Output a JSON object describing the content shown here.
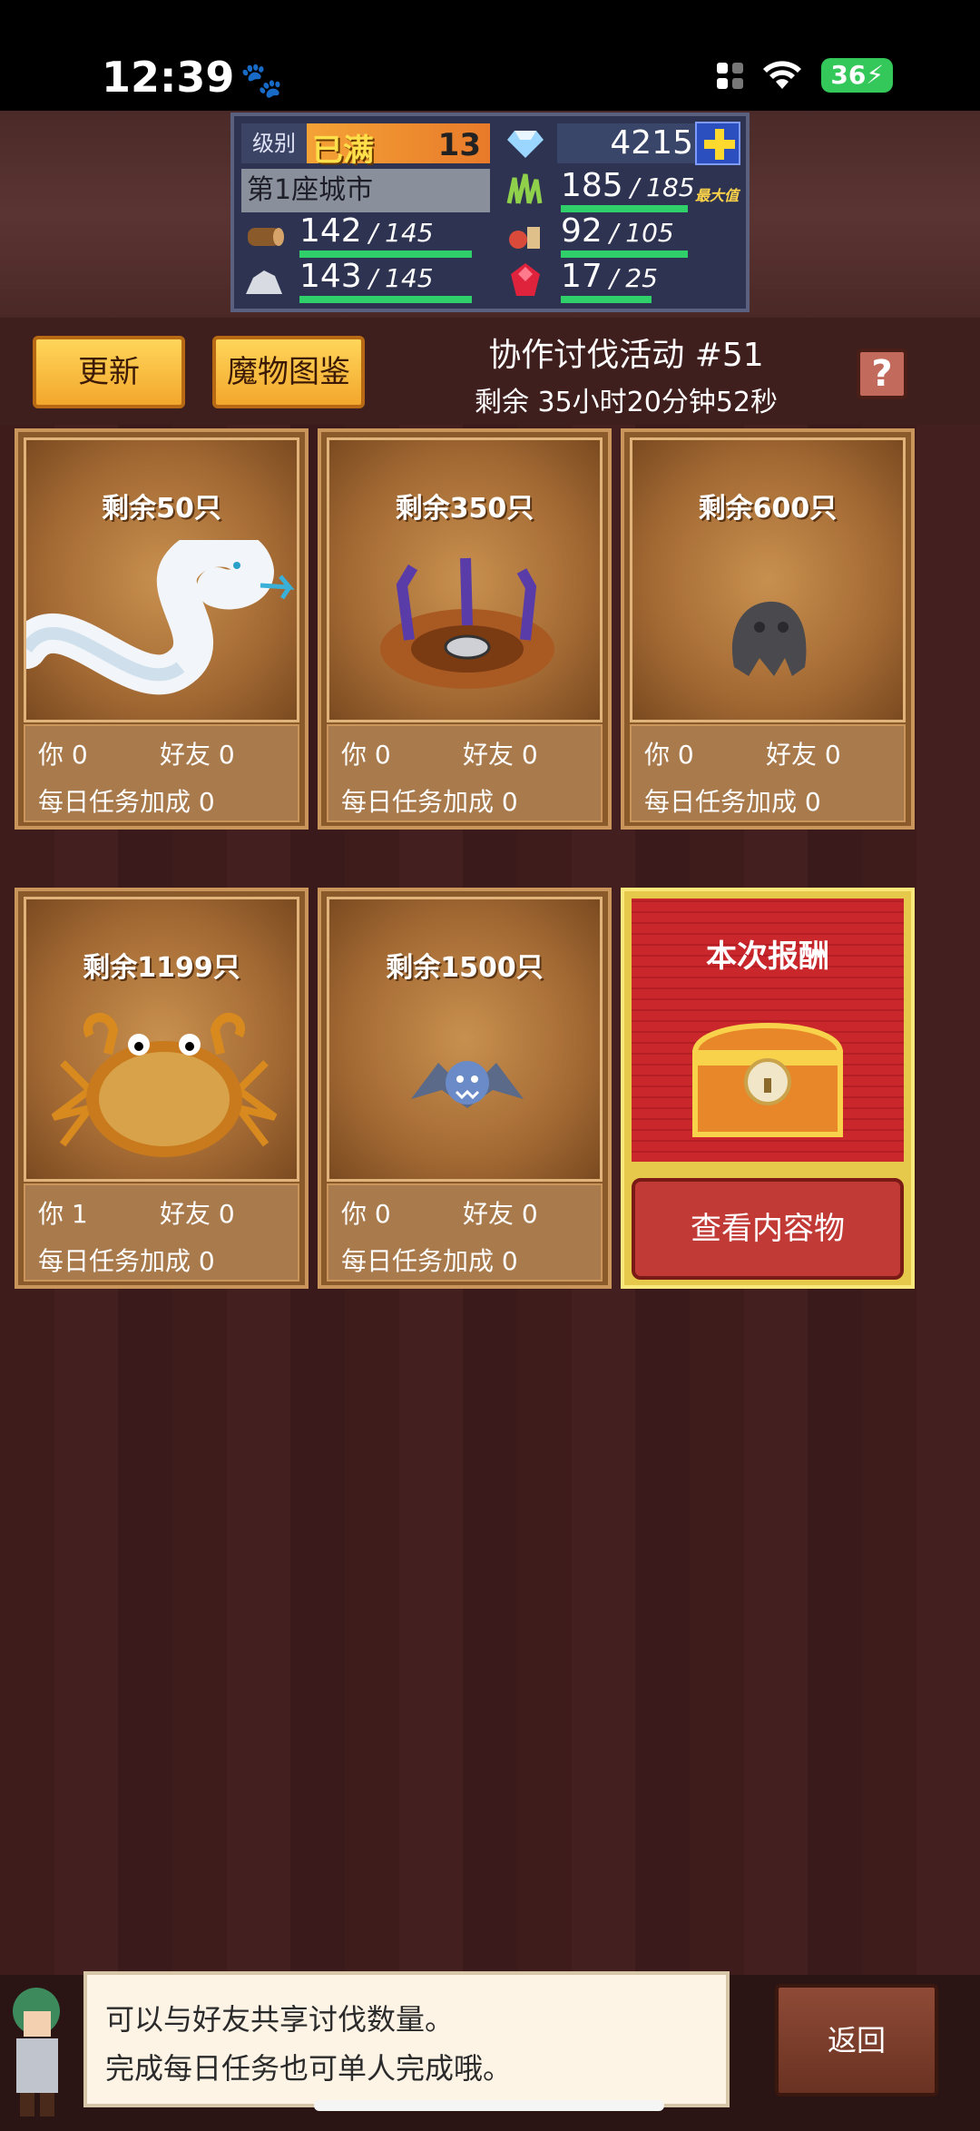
{
  "status": {
    "time": "12:39",
    "battery": "36"
  },
  "stats": {
    "level_label": "级别",
    "level_max": "已满",
    "level_num": "13",
    "gems": "4215",
    "city": "第1座城市",
    "grass": {
      "cur": "185",
      "max": "185",
      "tag": "最大值"
    },
    "wood": {
      "cur": "142",
      "max": "145"
    },
    "food": {
      "cur": "92",
      "max": "105"
    },
    "ore": {
      "cur": "143",
      "max": "145"
    },
    "ruby": {
      "cur": "17",
      "max": "25"
    },
    "sep": "/"
  },
  "header": {
    "refresh": "更新",
    "bestiary": "魔物图鉴",
    "title": "协作讨伐活动 #51",
    "timer": "剩余 35小时20分钟52秒",
    "help": "?"
  },
  "cards": [
    {
      "remaining": "剩余50只",
      "you": "你 0",
      "friend": "好友 0",
      "daily": "每日任务加成 0",
      "monster": "white-snake"
    },
    {
      "remaining": "剩余350只",
      "you": "你 0",
      "friend": "好友 0",
      "daily": "每日任务加成 0",
      "monster": "pit-trap"
    },
    {
      "remaining": "剩余600只",
      "you": "你 0",
      "friend": "好友 0",
      "daily": "每日任务加成 0",
      "monster": "rock-golem"
    },
    {
      "remaining": "剩余1199只",
      "you": "你 1",
      "friend": "好友 0",
      "daily": "每日任务加成 0",
      "monster": "crab"
    },
    {
      "remaining": "剩余1500只",
      "you": "你 0",
      "friend": "好友 0",
      "daily": "每日任务加成 0",
      "monster": "bat"
    }
  ],
  "reward": {
    "title": "本次报酬",
    "button": "查看内容物"
  },
  "dialog": {
    "line1": "可以与好友共享讨伐数量。",
    "line2": "完成每日任务也可单人完成哦。"
  },
  "back": "返回"
}
